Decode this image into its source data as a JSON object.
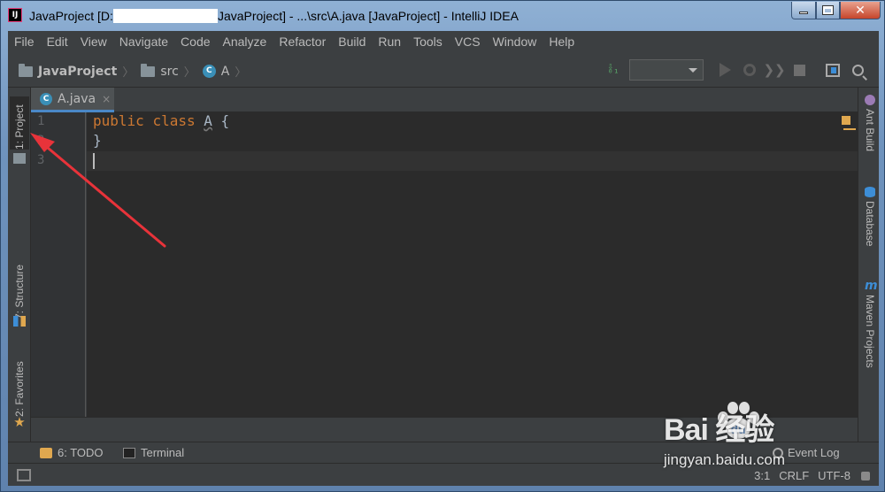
{
  "window": {
    "title_prefix": "JavaProject [D:",
    "title_suffix": "JavaProject] - ...\\src\\A.java [JavaProject] - IntelliJ IDEA",
    "app_icon_text": "IJ",
    "close_glyph": "✕"
  },
  "menu": {
    "items": [
      "File",
      "Edit",
      "View",
      "Navigate",
      "Code",
      "Analyze",
      "Refactor",
      "Build",
      "Run",
      "Tools",
      "VCS",
      "Window",
      "Help"
    ]
  },
  "breadcrumb": {
    "items": [
      "JavaProject",
      "src",
      "A"
    ],
    "separator": "〉"
  },
  "toolbar": {
    "build_icon": "hammer-icon",
    "run_configuration_value": "",
    "icons": [
      "run-icon",
      "debug-icon",
      "coverage-icon",
      "stop-icon",
      "project-structure-icon",
      "search-icon"
    ]
  },
  "left_tools": {
    "project": "1: Project",
    "structure": "7: Structure",
    "favorites": "2: Favorites"
  },
  "right_tools": {
    "ant": "Ant Build",
    "database": "Database",
    "maven": "Maven Projects"
  },
  "editor": {
    "tab_label": "A.java",
    "tab_close": "×",
    "class_icon_letter": "C",
    "line_numbers": [
      "1",
      "2",
      "3"
    ],
    "code": {
      "keyword_public": "public",
      "keyword_class": "class",
      "class_name": "A",
      "open_brace": "{",
      "close_brace": "}"
    }
  },
  "bottom_tools": {
    "todo": "6: TODO",
    "terminal": "Terminal",
    "event_log": "Event Log"
  },
  "status": {
    "position": "3:1",
    "line_separator": "CRLF",
    "encoding": "UTF-8"
  },
  "watermark": {
    "brand": "Bai  经验",
    "url": "jingyan.baidu.com"
  },
  "colors": {
    "keyword": "#cc7832",
    "editor_bg": "#2b2b2b",
    "annotation_arrow": "#e8333a",
    "accent": "#4a88c7"
  }
}
